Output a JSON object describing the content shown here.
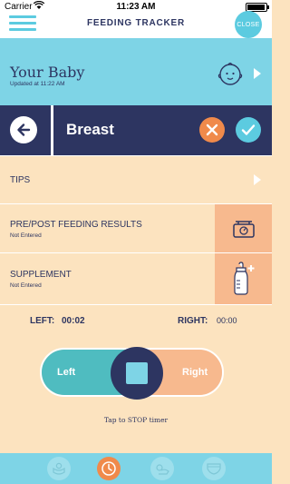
{
  "status_bar": {
    "carrier": "Carrier",
    "time": "11:23 AM"
  },
  "header": {
    "title": "FEEDING TRACKER",
    "close_label": "CLOSE",
    "menu_icon": "hamburger-menu-icon"
  },
  "baby": {
    "name": "Your Baby",
    "updated": "Updated at 11:22 AM",
    "icon": "baby-face-icon"
  },
  "feeding_type": {
    "title": "Breast",
    "back_icon": "arrow-left-icon",
    "cancel_icon": "x-icon",
    "confirm_icon": "checkmark-icon"
  },
  "rows": {
    "tips": {
      "label": "TIPS"
    },
    "prepost": {
      "label": "PRE/POST FEEDING RESULTS",
      "status": "Not Entered",
      "icon": "scale-icon"
    },
    "supplement": {
      "label": "SUPPLEMENT",
      "status": "Not Entered",
      "icon": "bottle-plus-icon"
    }
  },
  "timer": {
    "left_label": "LEFT:",
    "left_value": "00:02",
    "right_label": "RIGHT:",
    "right_value": "00:00",
    "toggle_left": "Left",
    "toggle_right": "Right",
    "hint": "Tap to STOP timer"
  },
  "tabs": [
    {
      "icon": "diaper-change-icon",
      "active": false
    },
    {
      "icon": "clock-icon",
      "active": true
    },
    {
      "icon": "sleeping-baby-icon",
      "active": false
    },
    {
      "icon": "diaper-icon",
      "active": false
    }
  ],
  "colors": {
    "navy": "#2d3561",
    "sky": "#7ed4e6",
    "cyan": "#5ccbe0",
    "peach": "#fce3bf",
    "apricot": "#f7b98e",
    "orange": "#f08a4b",
    "teal": "#4fbcc0"
  }
}
